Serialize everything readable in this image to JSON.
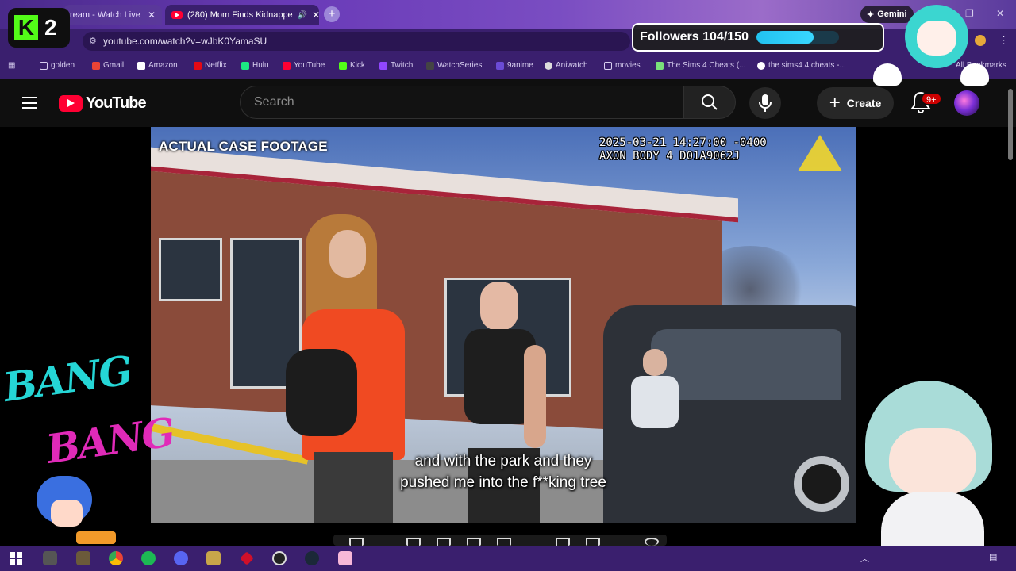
{
  "browser": {
    "tabs": [
      {
        "label": "ream - Watch Live",
        "active": false
      },
      {
        "label": "(280) Mom Finds Kidnappe",
        "active": true
      }
    ],
    "gemini_label": "Gemini",
    "url": "youtube.com/watch?v=wJbK0YamaSU",
    "bookmarks": [
      "golden",
      "Gmail",
      "Amazon",
      "Netflix",
      "Hulu",
      "YouTube",
      "Kick",
      "Twitch",
      "WatchSeries",
      "9anime",
      "Aniwatch",
      "movies",
      "The Sims 4 Cheats (...",
      "the sims4 4 cheats -...",
      "All Bookmarks"
    ]
  },
  "youtube": {
    "logo_text": "YouTube",
    "search_placeholder": "Search",
    "create_label": "Create",
    "notification_badge": "9+"
  },
  "video": {
    "case_label": "ACTUAL CASE FOOTAGE",
    "timestamp": "2025-03-21 14:27:00 -0400",
    "device": "AXON BODY 4 D01A9062J",
    "caption_line1": "and with the park and they",
    "caption_line2": "pushed me into the f**king tree"
  },
  "overlay": {
    "kick_badge_number": "2",
    "followers_label": "Followers 104/150",
    "followers_current": 104,
    "followers_goal": 150,
    "bang1": "BANG",
    "bang2": "BANG"
  },
  "colors": {
    "youtube_red": "#ff0033",
    "kick_green": "#53fc18",
    "browser_purple": "#3a1f6e",
    "progress_cyan": "#22c3f0"
  }
}
